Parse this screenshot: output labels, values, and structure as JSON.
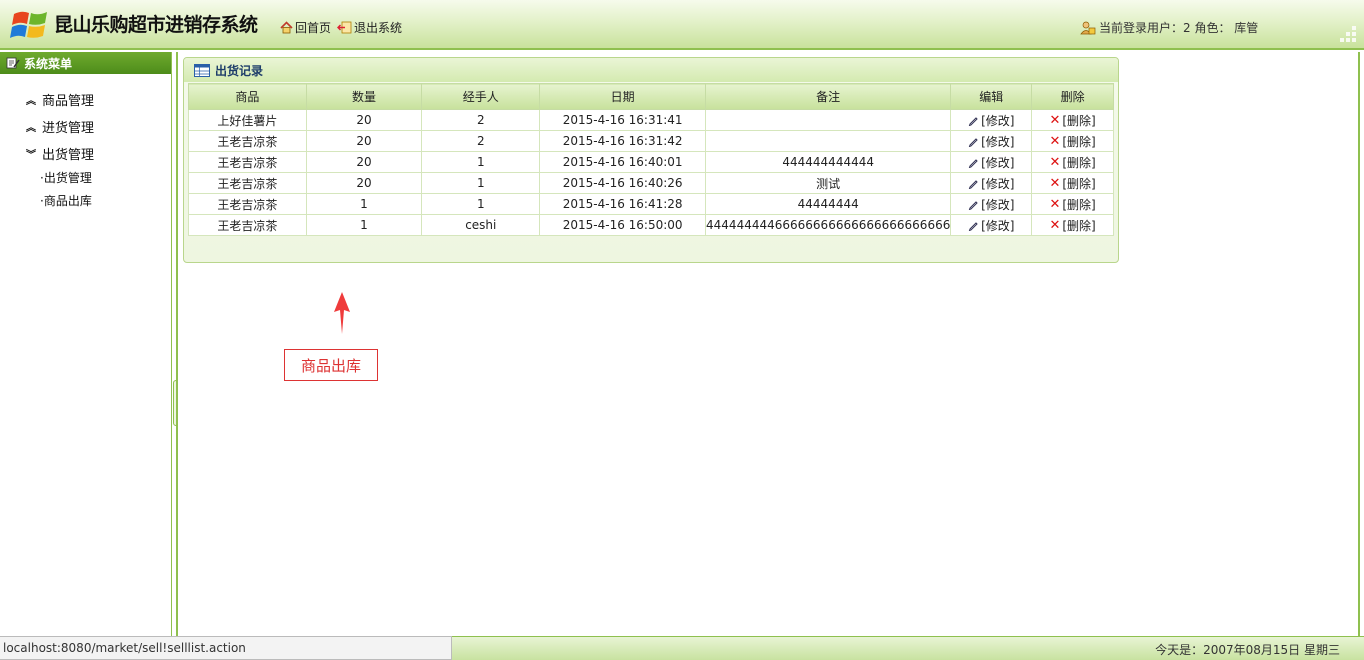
{
  "header": {
    "app_title": "昆山乐购超市进销存系统",
    "home_label": "回首页",
    "logout_label": "退出系统",
    "user_info": "当前登录用户：2 角色： 库管"
  },
  "sidebar": {
    "title": "系统菜单",
    "groups": [
      {
        "label": "商品管理",
        "icon": "chevron-up-double"
      },
      {
        "label": "进货管理",
        "icon": "chevron-up-double"
      },
      {
        "label": "出货管理",
        "icon": "chevron-down-double"
      }
    ],
    "submenu": [
      {
        "label": "出货管理"
      },
      {
        "label": "商品出库"
      }
    ]
  },
  "panel": {
    "title": "出货记录",
    "columns": [
      "商品",
      "数量",
      "经手人",
      "日期",
      "备注",
      "编辑",
      "删除"
    ],
    "rows": [
      {
        "product": "上好佳薯片",
        "qty": "20",
        "handler": "2",
        "date": "2015-4-16 16:31:41",
        "note": "",
        "edit": "[修改]",
        "delete": "[删除]"
      },
      {
        "product": "王老吉凉茶",
        "qty": "20",
        "handler": "2",
        "date": "2015-4-16 16:31:42",
        "note": "",
        "edit": "[修改]",
        "delete": "[删除]"
      },
      {
        "product": "王老吉凉茶",
        "qty": "20",
        "handler": "1",
        "date": "2015-4-16 16:40:01",
        "note": "444444444444",
        "edit": "[修改]",
        "delete": "[删除]"
      },
      {
        "product": "王老吉凉茶",
        "qty": "20",
        "handler": "1",
        "date": "2015-4-16 16:40:26",
        "note": "测试",
        "edit": "[修改]",
        "delete": "[删除]"
      },
      {
        "product": "王老吉凉茶",
        "qty": "1",
        "handler": "1",
        "date": "2015-4-16 16:41:28",
        "note": "44444444",
        "edit": "[修改]",
        "delete": "[删除]"
      },
      {
        "product": "王老吉凉茶",
        "qty": "1",
        "handler": "ceshi",
        "date": "2015-4-16 16:50:00",
        "note": "44444444466666666666666666666666",
        "edit": "[修改]",
        "delete": "[删除]"
      }
    ]
  },
  "annotation": {
    "label": "商品出库",
    "color": "#dd3333"
  },
  "footer": {
    "date_text": "今天是：2007年08月15日 星期三"
  },
  "statusbar": {
    "url": "localhost:8080/market/sell!selllist.action"
  },
  "colors": {
    "accent_green": "#8fc04f",
    "sidebar_header": "#4d8c1a",
    "delete_red": "#dd1111"
  }
}
